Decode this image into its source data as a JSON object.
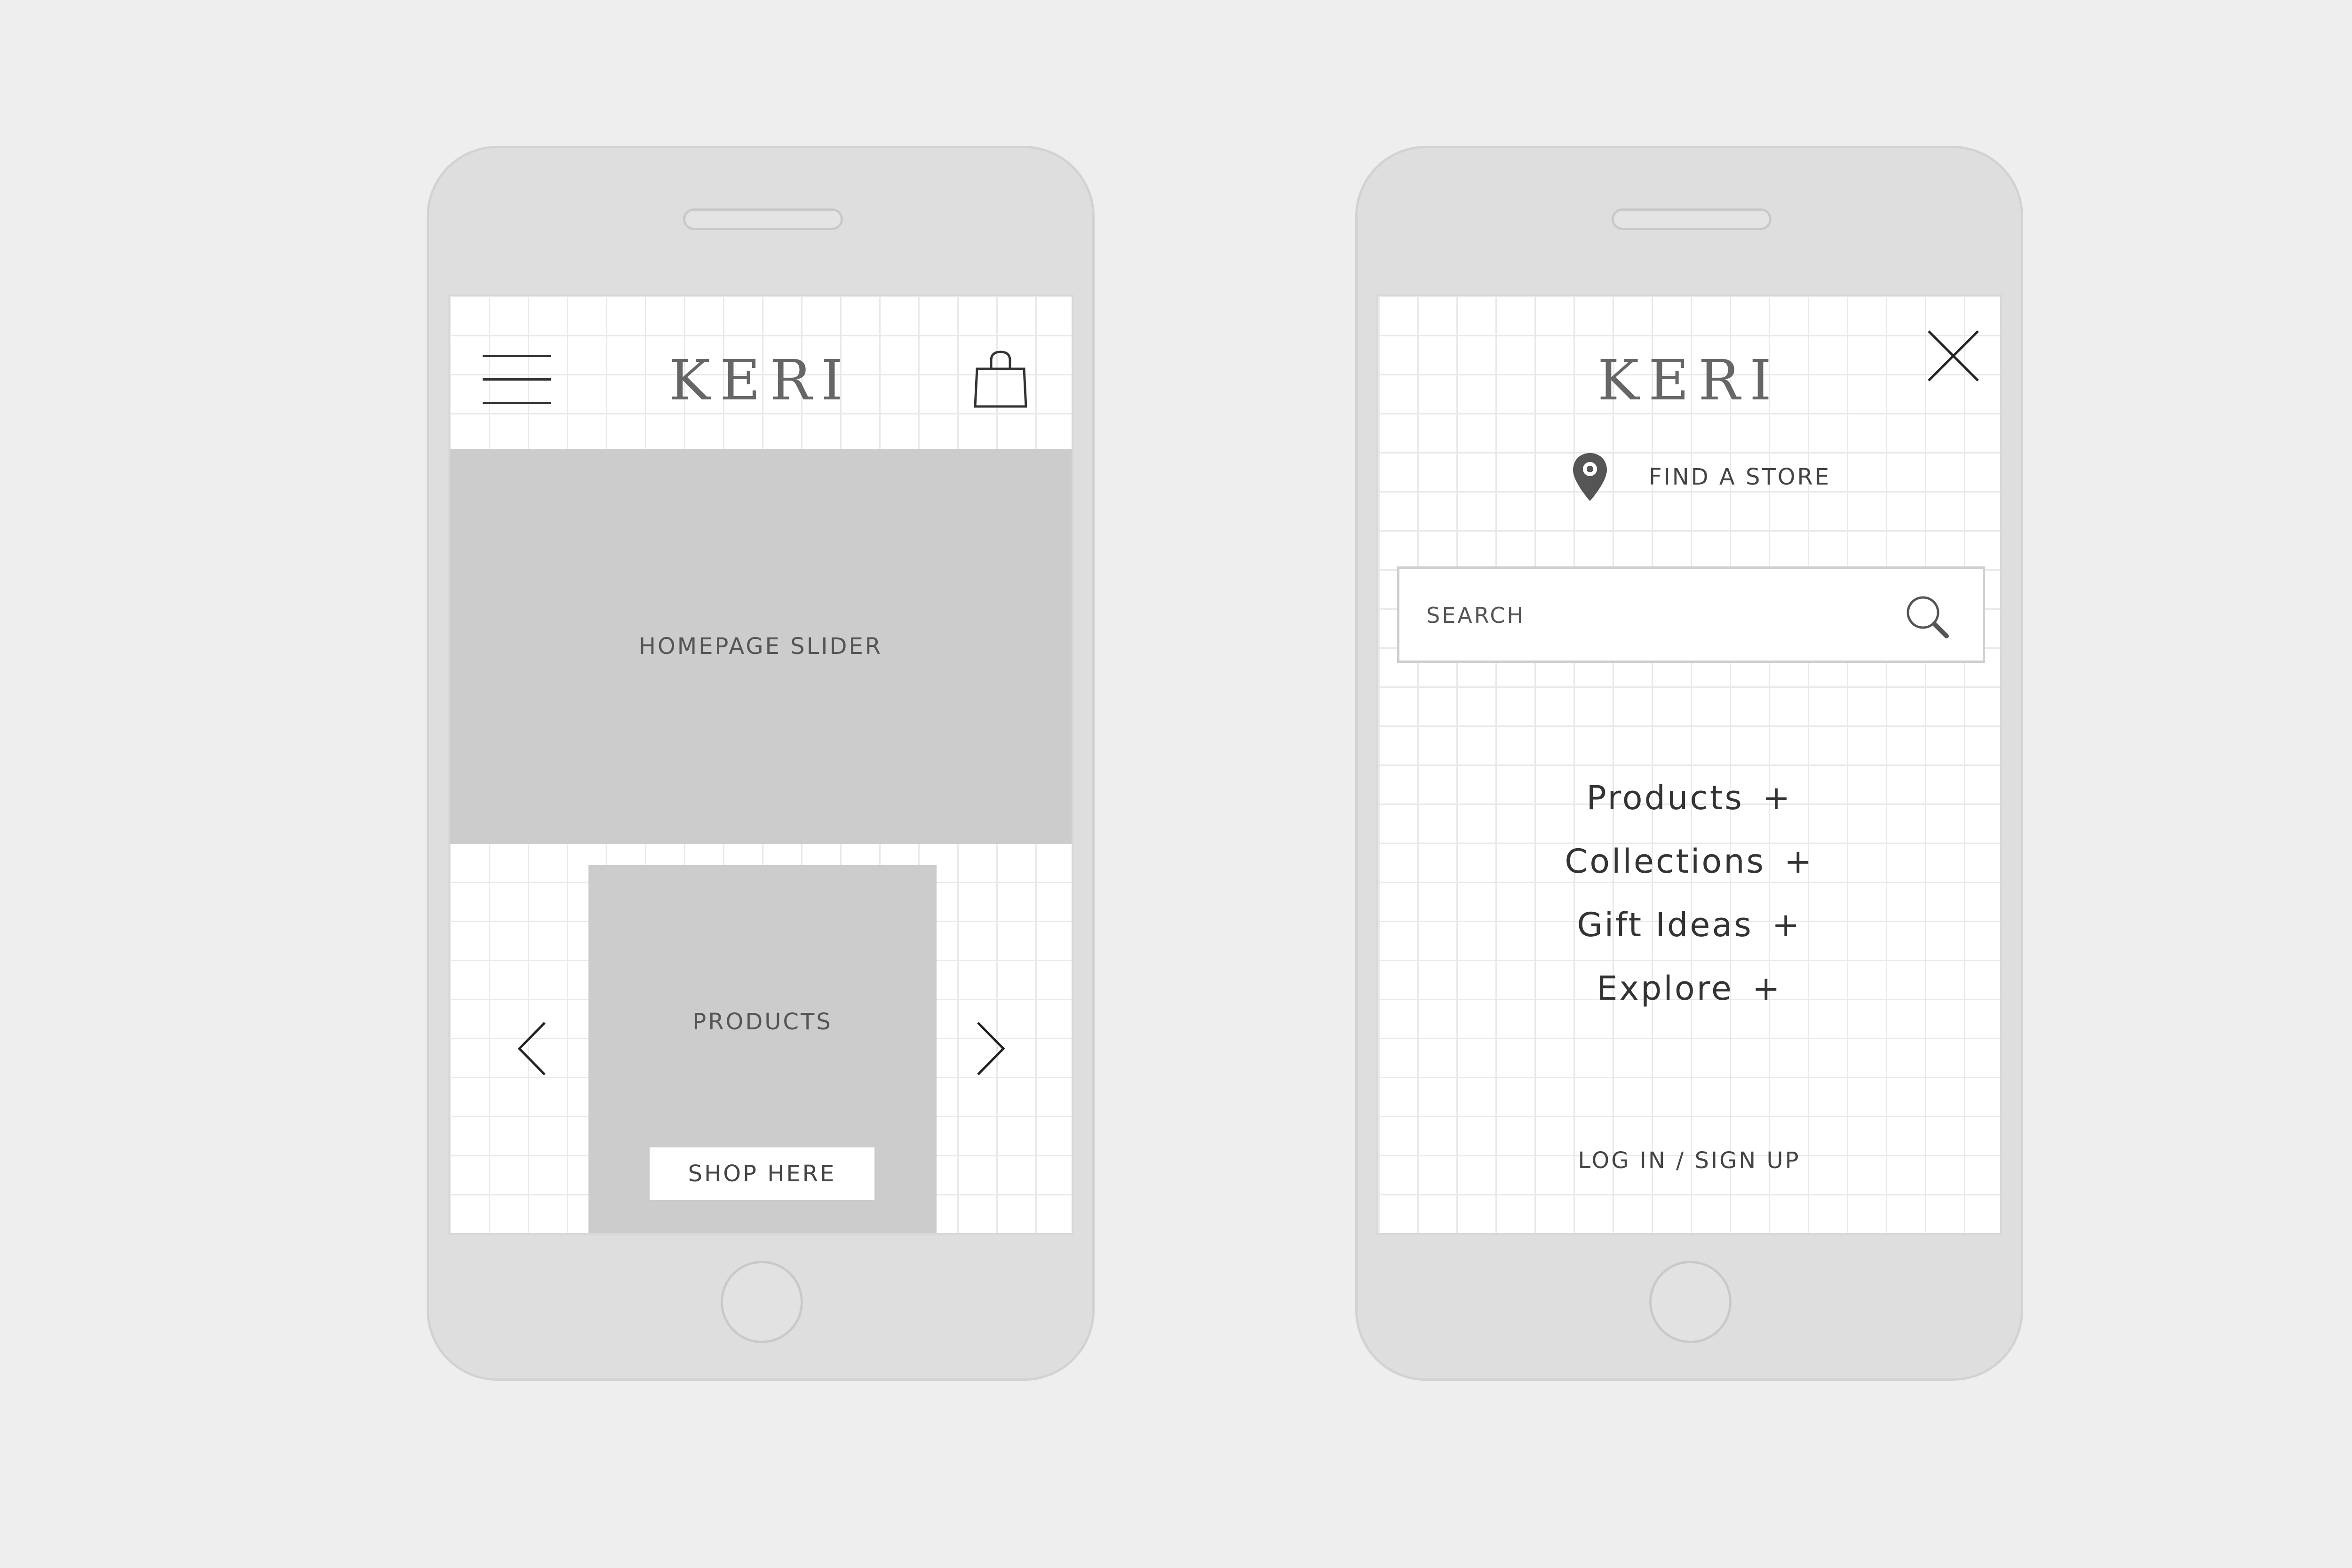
{
  "left_phone": {
    "logo": "KERI",
    "slider_label": "HOMEPAGE SLIDER",
    "products_label": "PRODUCTS",
    "shop_button_label": "SHOP HERE"
  },
  "right_phone": {
    "logo": "KERI",
    "find_store_label": "FIND A STORE",
    "search": {
      "placeholder": "SEARCH"
    },
    "menu_items": [
      {
        "label": "Products",
        "suffix": "+"
      },
      {
        "label": "Collections",
        "suffix": "+"
      },
      {
        "label": "Gift Ideas",
        "suffix": "+"
      },
      {
        "label": "Explore",
        "suffix": "+"
      }
    ],
    "auth_label": "LOG IN / SIGN UP"
  },
  "icons": {
    "menu": "hamburger-icon",
    "cart": "shopping-bag-icon",
    "previous": "chevron-left-icon",
    "next": "chevron-right-icon",
    "close": "close-icon",
    "location": "location-pin-icon",
    "search": "search-icon"
  },
  "colors": {
    "background": "#eeeeee",
    "phone_body": "#dedede",
    "placeholder_block": "#cccccc",
    "logo_text": "#666666",
    "body_text": "#444444"
  }
}
